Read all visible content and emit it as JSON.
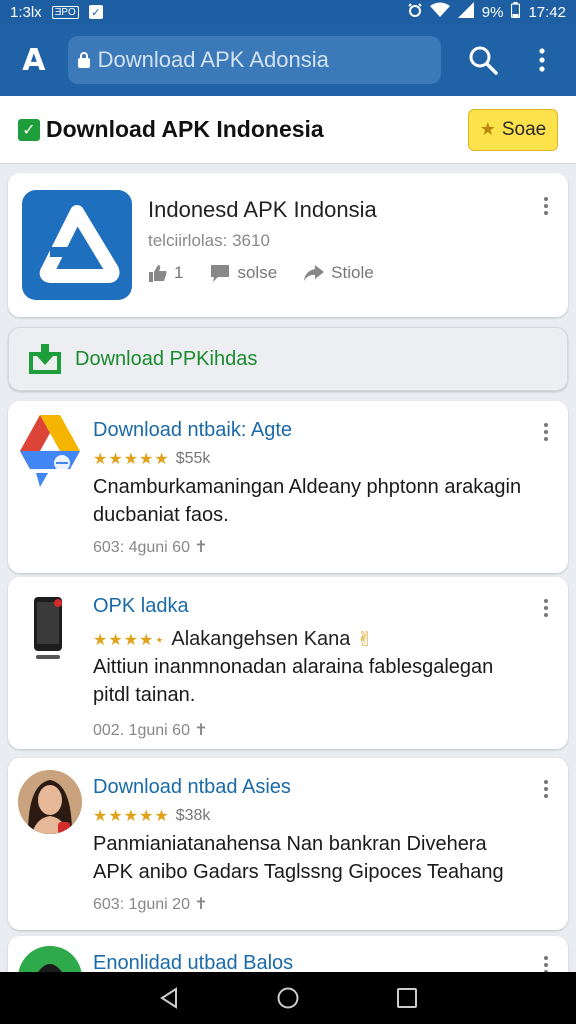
{
  "status_bar": {
    "time_left": "1:3lx",
    "mini_badge": "ƎPO",
    "battery": "9%",
    "clock": "17:42"
  },
  "app_bar": {
    "logo": "A",
    "search_placeholder": "Download APK Adonsia"
  },
  "header": {
    "title": "Download APK Indonesia",
    "save_label": "Soae"
  },
  "featured": {
    "name": "Indonesd APK Indonsia",
    "subtitle": "telciirlolas: 3610",
    "likes": "1",
    "action_2": "solse",
    "action_3": "Stiole"
  },
  "banner": {
    "label": "Download PPKihdas"
  },
  "apps": [
    {
      "title": "Download ntbaik: Agte",
      "stars": "★★★★★",
      "rating_text": "$55k",
      "desc_line1": "Cnamburkamaningan Aldeany phptonn arakagin",
      "desc_line2": "ducbaniat faos.",
      "meta": "603: 4guni 60 ✝",
      "icon": "drive-icon"
    },
    {
      "title": "OPK ladka",
      "stars": "★★★★⋆",
      "rating_text": "Alakangehsen Kana",
      "rating_emoji": "✌",
      "desc_line1": "Aittiun inanmnonadan alaraina fablesgalegan",
      "desc_line2": "pitdl tainan.",
      "meta": "002. 1guni 60 ✝",
      "icon": "phone-icon"
    },
    {
      "title": "Download ntbad Asies",
      "stars": "★★★★★",
      "rating_text": "$38k",
      "desc_line1": "Panmianiatanahensa Nan bankran Divehera",
      "desc_line2": "APK anibo Gadars Taglssng Gipoces Teahang",
      "meta": "603: 1guni 20 ✝",
      "icon": "avatar-icon"
    },
    {
      "title": "Enonlidad utbad Balos",
      "icon": "avatar-icon"
    }
  ],
  "colors": {
    "app_bar": "#1f62a6",
    "accent_green": "#1a8a2e",
    "link_blue": "#1a6aa8",
    "star": "#e0a21b",
    "save_yellow": "#fde24b"
  }
}
